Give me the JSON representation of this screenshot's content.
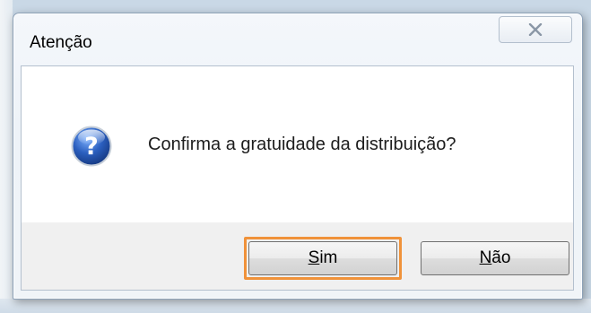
{
  "window": {
    "title": "Atenção",
    "close_icon": "close-icon"
  },
  "message": {
    "icon": "question-icon",
    "text": "Confirma a gratuidade da distribuição?"
  },
  "buttons": {
    "yes": {
      "accel": "S",
      "rest": "im"
    },
    "no": {
      "accel": "N",
      "rest": "ão"
    }
  },
  "colors": {
    "focus_highlight": "#f0923a",
    "icon_blue": "#1f4fa3"
  }
}
